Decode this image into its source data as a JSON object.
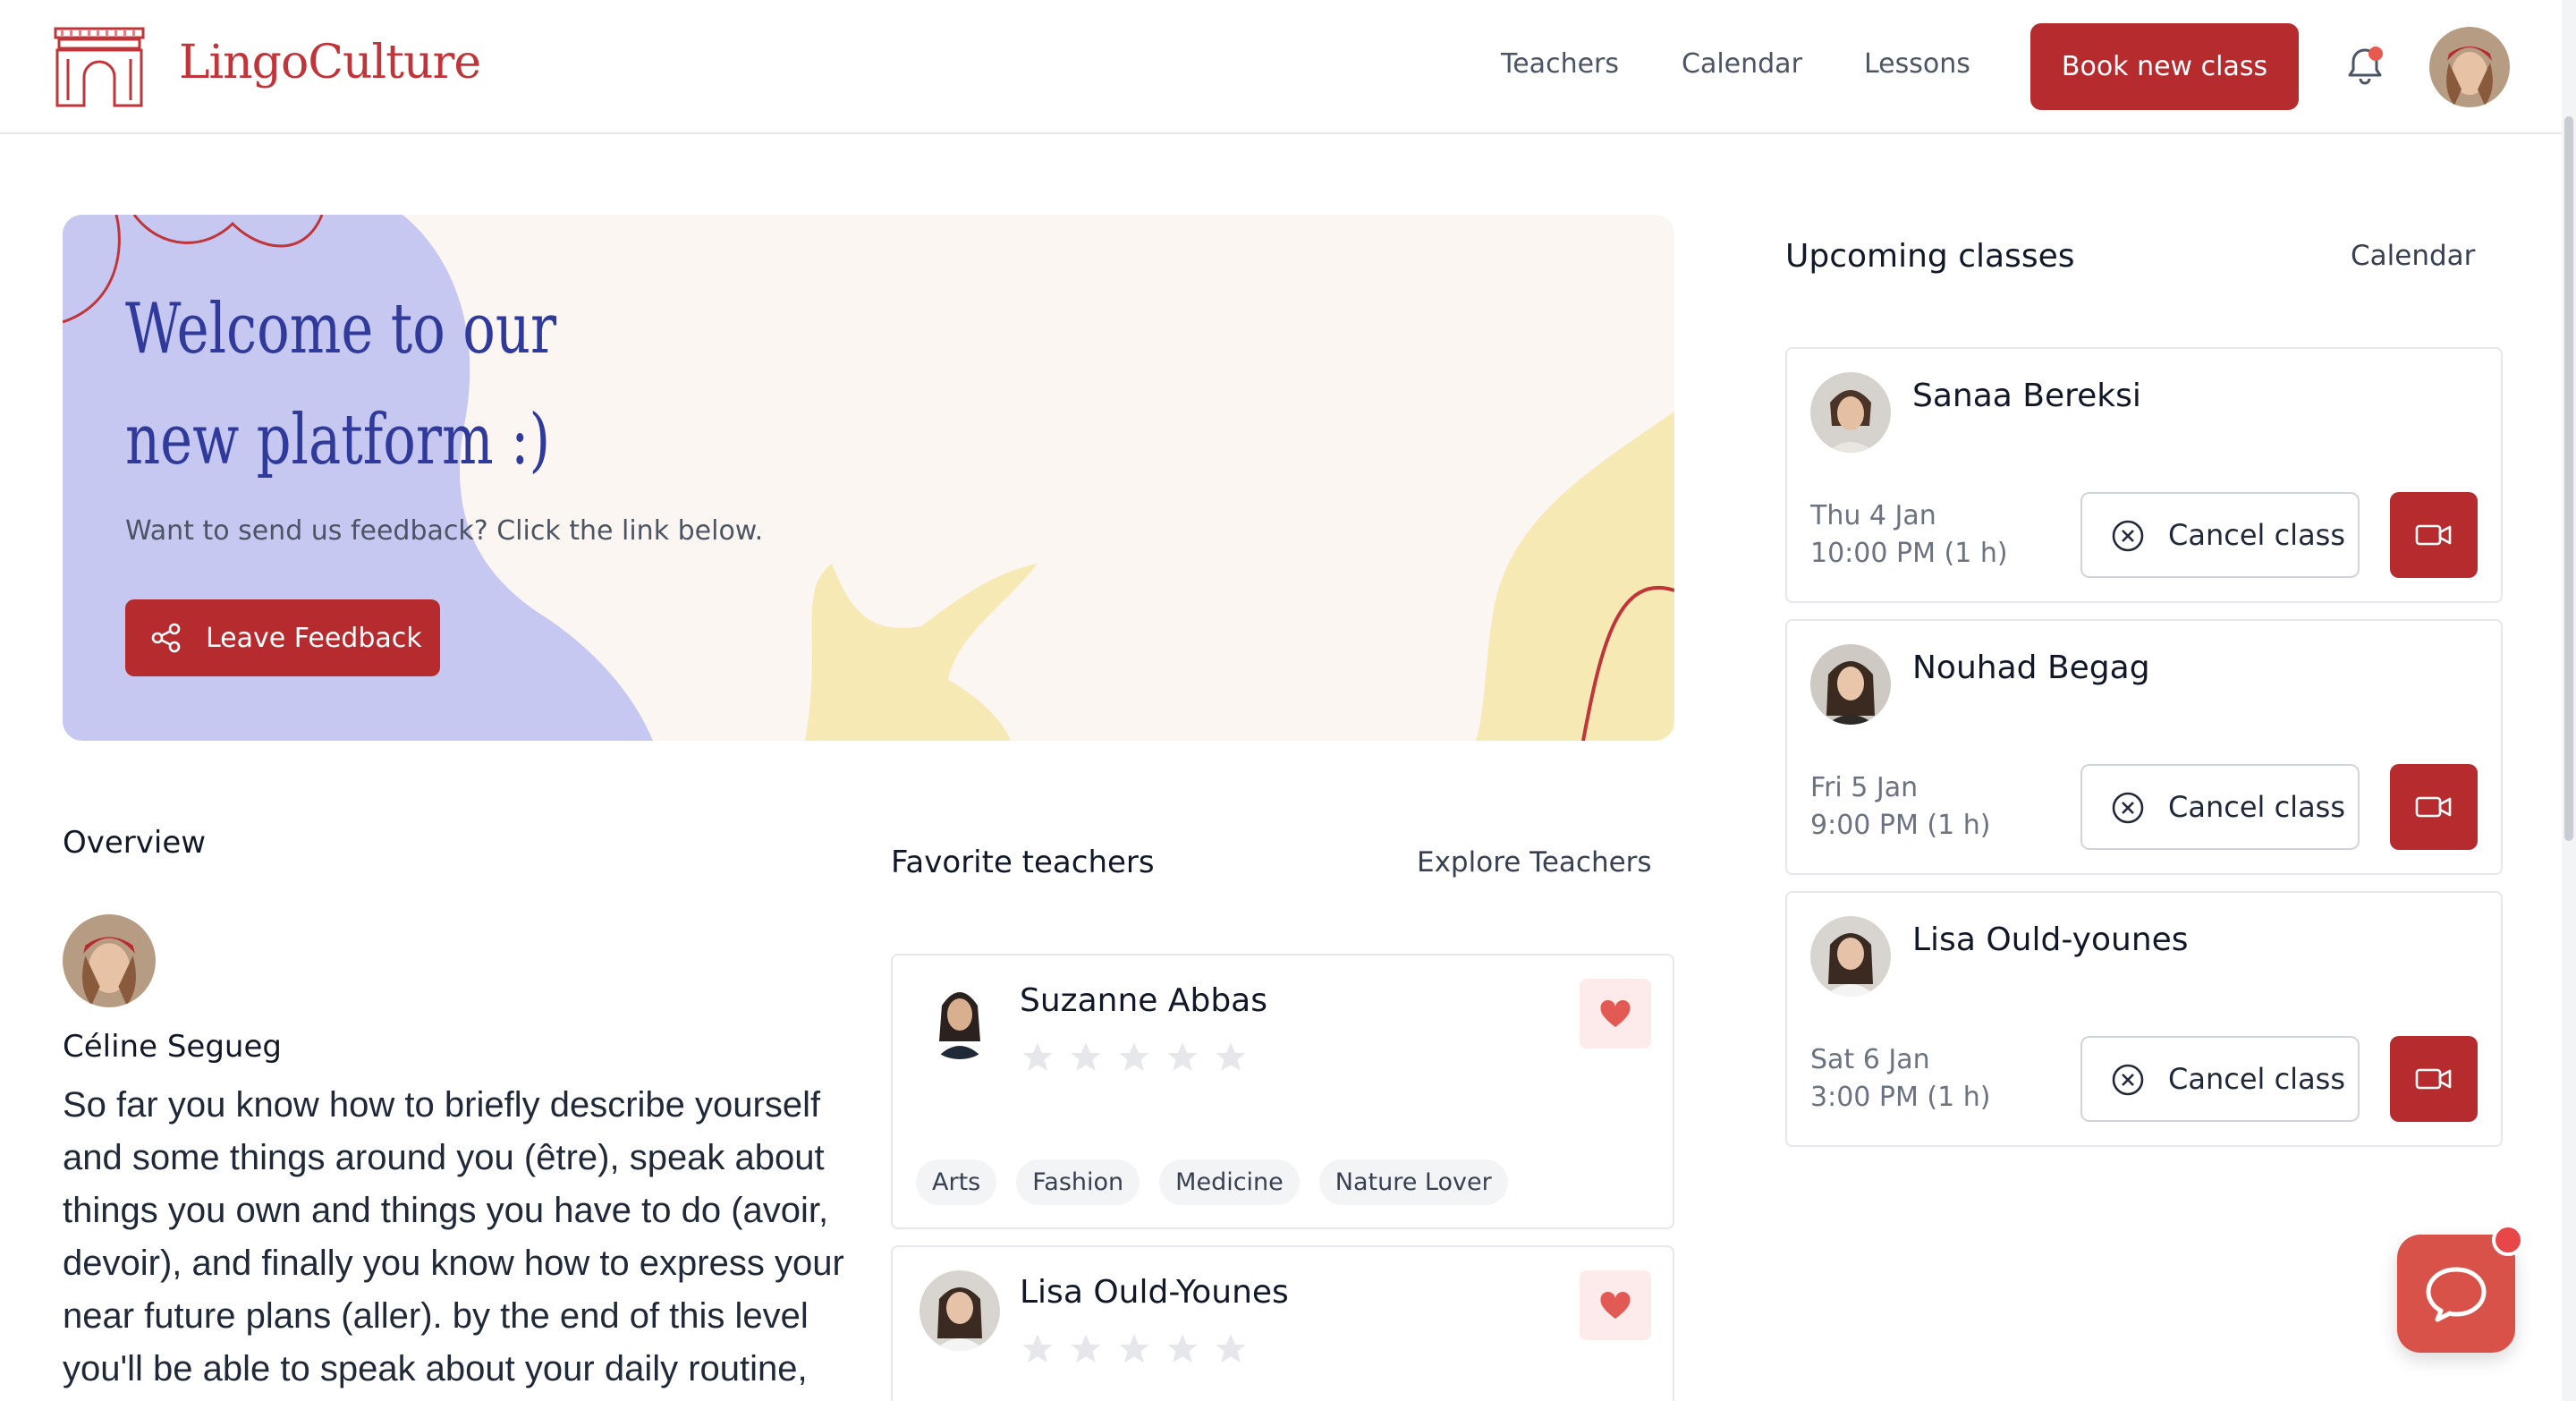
{
  "brand": {
    "logo_text": "LingoCulture",
    "accent": "#b62b2e"
  },
  "nav": {
    "teachers": "Teachers",
    "calendar": "Calendar",
    "lessons": "Lessons",
    "book_button": "Book new class",
    "bell_icon": "bell-icon",
    "has_notification": true
  },
  "hero": {
    "title": "Welcome to our new platform :)",
    "subtitle": "Want to send us feedback? Click the link below.",
    "button": "Leave Feedback"
  },
  "overview": {
    "title": "Overview",
    "name": "Céline Segueg",
    "text": "So far you know how to briefly describe yourself and some things around you (être), speak about things you own and things you have to do (avoir, devoir), and finally you know how to express your near future plans (aller). by the end of this level you'll be able to speak about your daily routine,"
  },
  "favorites": {
    "title": "Favorite teachers",
    "explore_link": "Explore Teachers",
    "teachers": [
      {
        "name": "Suzanne Abbas",
        "rating": 0,
        "tags": [
          "Arts",
          "Fashion",
          "Medicine",
          "Nature Lover"
        ]
      },
      {
        "name": "Lisa Ould-Younes",
        "rating": 0,
        "tags": []
      }
    ]
  },
  "upcoming": {
    "title": "Upcoming classes",
    "calendar_link": "Calendar",
    "cancel_label": "Cancel class",
    "classes": [
      {
        "teacher": "Sanaa Bereksi",
        "date": "Thu 4 Jan",
        "time": "10:00 PM (1 h)"
      },
      {
        "teacher": "Nouhad Begag",
        "date": "Fri 5 Jan",
        "time": "9:00 PM (1 h)"
      },
      {
        "teacher": "Lisa Ould-younes",
        "date": "Sat 6 Jan",
        "time": "3:00 PM (1 h)"
      }
    ]
  }
}
